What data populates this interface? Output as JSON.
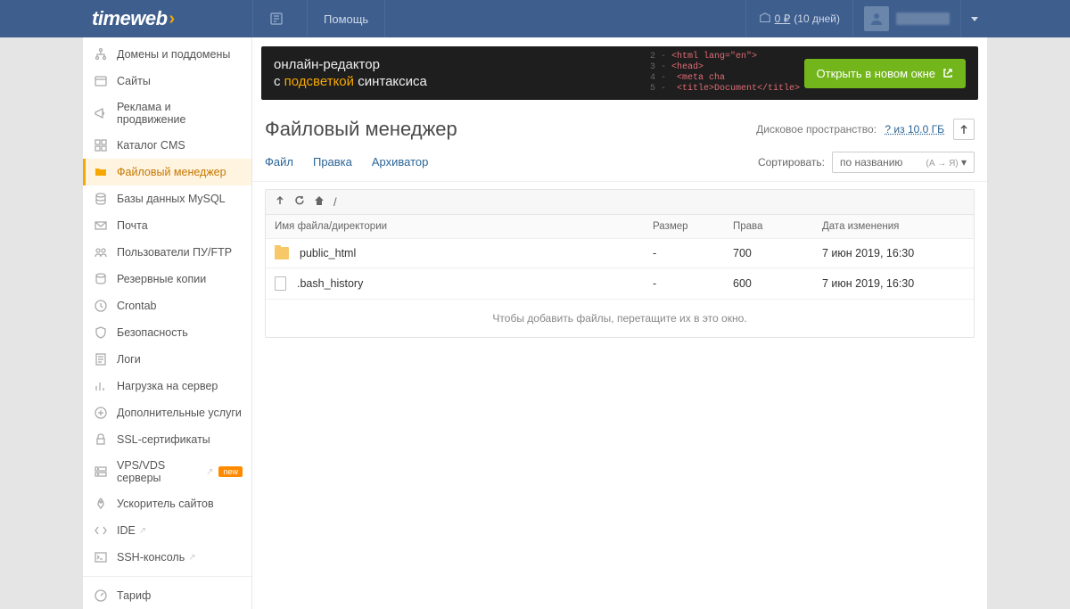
{
  "header": {
    "logo": "timeweb",
    "help_label": "Помощь",
    "balance_amount": "0",
    "balance_currency": "₽",
    "balance_days": "(10 дней)"
  },
  "sidebar": {
    "items": [
      {
        "label": "Домены и поддомены",
        "icon": "sitemap"
      },
      {
        "label": "Сайты",
        "icon": "window"
      },
      {
        "label": "Реклама и продвижение",
        "icon": "megaphone"
      },
      {
        "label": "Каталог CMS",
        "icon": "grid"
      },
      {
        "label": "Файловый менеджер",
        "icon": "folder",
        "active": true
      },
      {
        "label": "Базы данных MySQL",
        "icon": "database"
      },
      {
        "label": "Почта",
        "icon": "mail"
      },
      {
        "label": "Пользователи ПУ/FTP",
        "icon": "users"
      },
      {
        "label": "Резервные копии",
        "icon": "backup"
      },
      {
        "label": "Crontab",
        "icon": "clock"
      },
      {
        "label": "Безопасность",
        "icon": "shield"
      },
      {
        "label": "Логи",
        "icon": "log"
      },
      {
        "label": "Нагрузка на сервер",
        "icon": "chart"
      },
      {
        "label": "Дополнительные услуги",
        "icon": "plus"
      },
      {
        "label": "SSL-сертификаты",
        "icon": "lock"
      },
      {
        "label": "VPS/VDS серверы",
        "icon": "server",
        "arrow": true,
        "badge": "new"
      },
      {
        "label": "Ускоритель сайтов",
        "icon": "rocket"
      },
      {
        "label": "IDE",
        "icon": "code",
        "arrow": true
      },
      {
        "label": "SSH-консоль",
        "icon": "terminal",
        "arrow": true
      }
    ],
    "bottom": {
      "label": "Тариф",
      "icon": "gauge"
    }
  },
  "banner": {
    "line1": "онлайн-редактор",
    "line2_pre": "с ",
    "line2_hl": "подсветкой",
    "line2_post": " синтаксиса",
    "button": "Открыть в новом окне",
    "code_lines": [
      {
        "n": "2",
        "html": "<html lang=\"en\">"
      },
      {
        "n": "3",
        "html": "<head>"
      },
      {
        "n": "4",
        "html": "    <meta cha"
      },
      {
        "n": "5",
        "html": "    <title>Document</title>"
      }
    ]
  },
  "page": {
    "title": "Файловый менеджер",
    "disk_label": "Дисковое пространство:",
    "disk_value": "? из 10.0 ГБ"
  },
  "tabs": [
    "Файл",
    "Правка",
    "Архиватор"
  ],
  "sort": {
    "label": "Сортировать:",
    "value": "по названию",
    "direction": "(А → Я)"
  },
  "path": "/",
  "columns": {
    "name": "Имя файла/директории",
    "size": "Размер",
    "perm": "Права",
    "date": "Дата изменения"
  },
  "files": [
    {
      "name": "public_html",
      "type": "folder",
      "size": "-",
      "perm": "700",
      "date": "7 июн 2019, 16:30"
    },
    {
      "name": ".bash_history",
      "type": "file",
      "size": "-",
      "perm": "600",
      "date": "7 июн 2019, 16:30"
    }
  ],
  "drop_hint": "Чтобы добавить файлы, перетащите их в это окно."
}
